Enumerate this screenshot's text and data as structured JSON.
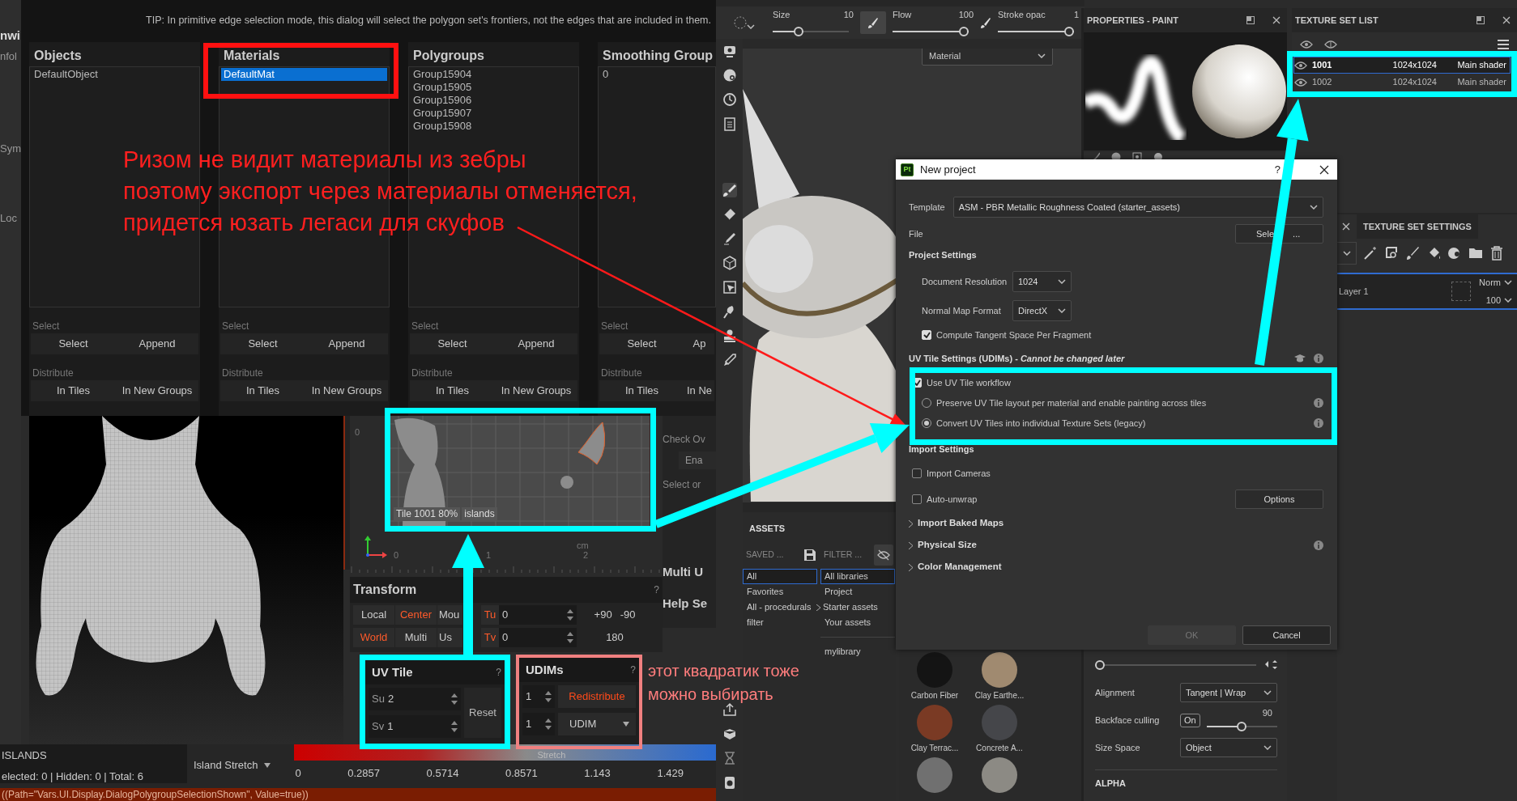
{
  "rizom": {
    "edge_labels": [
      "nwi",
      "nfol",
      "Sym",
      "Loc"
    ],
    "selection_dialog": {
      "tip": "TIP: In primitive edge selection mode, this dialog will select the polygon set's frontiers, not the edges that are included in them.",
      "columns": [
        {
          "title": "Objects",
          "items": [
            {
              "label": "DefaultObject",
              "selected": false
            }
          ],
          "select_label": "Select",
          "select_buttons": [
            "Select",
            "Append"
          ],
          "distribute_label": "Distribute",
          "distribute_buttons": [
            "In Tiles",
            "In New Groups"
          ]
        },
        {
          "title": "Materials",
          "items": [
            {
              "label": "DefaultMat",
              "selected": true
            }
          ],
          "select_label": "Select",
          "select_buttons": [
            "Select",
            "Append"
          ],
          "distribute_label": "Distribute",
          "distribute_buttons": [
            "In Tiles",
            "In New Groups"
          ]
        },
        {
          "title": "Polygroups",
          "items": [
            {
              "label": "Group15904",
              "selected": false
            },
            {
              "label": "Group15905",
              "selected": false
            },
            {
              "label": "Group15906",
              "selected": false
            },
            {
              "label": "Group15907",
              "selected": false
            },
            {
              "label": "Group15908",
              "selected": false
            }
          ],
          "select_label": "Select",
          "select_buttons": [
            "Select",
            "Append"
          ],
          "distribute_label": "Distribute",
          "distribute_buttons": [
            "In Tiles",
            "In New Groups"
          ]
        },
        {
          "title": "Smoothing Group",
          "items": [
            {
              "label": "0",
              "selected": false
            }
          ],
          "select_label": "Select",
          "select_buttons": [
            "Select",
            "Ap"
          ],
          "distribute_label": "Distribute",
          "distribute_buttons": [
            "In Tiles",
            "In Ne"
          ]
        }
      ]
    },
    "uv_view": {
      "tile_label": "Tile 1001 80%",
      "mode_label": "islands",
      "v_tick": "0",
      "u_ticks": [
        "0",
        "1",
        "2"
      ],
      "unit": "cm"
    },
    "side_labels": [
      {
        "text": "Check Ov",
        "kind": "label"
      },
      {
        "text": "Ena",
        "kind": "button"
      },
      {
        "text": "Select or",
        "kind": "label"
      },
      {
        "text": "Multi U",
        "kind": "heading"
      },
      {
        "text": "Help Se",
        "kind": "heading"
      }
    ],
    "transform": {
      "title": "Transform",
      "help": "?",
      "rows": [
        {
          "modes": [
            {
              "label": "Local",
              "selected": false
            },
            {
              "label": "Center",
              "selected": true
            },
            {
              "label": "Mou",
              "selected": false
            }
          ],
          "axis": "Tu",
          "value": "0",
          "presets": [
            "+90",
            "-90"
          ]
        },
        {
          "modes": [
            {
              "label": "World",
              "selected": true
            },
            {
              "label": "Multi",
              "selected": false
            },
            {
              "label": "Us",
              "selected": false
            }
          ],
          "axis": "Tv",
          "value": "0",
          "presets": [
            "180"
          ]
        }
      ]
    },
    "uv_tile": {
      "title": "UV Tile",
      "help": "?",
      "fields": [
        {
          "label": "Su",
          "value": "2"
        },
        {
          "label": "Sv",
          "value": "1"
        }
      ],
      "reset": "Reset"
    },
    "udims": {
      "title": "UDIMs",
      "help": "?",
      "fields": [
        "1",
        "1"
      ],
      "redistribute": "Redistribute",
      "mode": "UDIM"
    },
    "islands": {
      "title": "ISLANDS",
      "summary": "elected: 0 | Hidden: 0 | Total: 6",
      "display": "Island Stretch",
      "legend_label": "Stretch",
      "legend_ticks": [
        "0",
        "0.2857",
        "0.5714",
        "0.8571",
        "1.143",
        "1.429"
      ]
    },
    "status_line": "((Path=\"Vars.UI.Display.DialogPolygroupSelectionShown\", Value=true))"
  },
  "painter": {
    "toolbar": {
      "sliders": [
        {
          "label": "Size",
          "reading": "10",
          "level": 0.32
        },
        {
          "label": "Flow",
          "reading": "100",
          "level": 1
        },
        {
          "label": "Stroke opac",
          "reading": "1",
          "level": 1
        }
      ]
    },
    "viewport": {
      "channel": "Material"
    },
    "properties": {
      "title": "PROPERTIES - PAINT",
      "spacing_slider": {
        "level": 0
      },
      "alignment_label": "Alignment",
      "alignment": "Tangent | Wrap",
      "backface_label": "Backface culling",
      "backface": "On",
      "angle": "90",
      "angle_slider": {
        "level": 0.5
      },
      "size_space_label": "Size Space",
      "size_space": "Object",
      "section": "ALPHA"
    },
    "texture_sets": {
      "title": "TEXTURE SET LIST",
      "rows": [
        {
          "name": "1001",
          "size": "1024x1024",
          "shader": "Main shader",
          "selected": true
        },
        {
          "name": "1002",
          "size": "1024x1024",
          "shader": "Main shader",
          "selected": false
        }
      ]
    },
    "texture_set_settings": {
      "title": "TEXTURE SET SETTINGS",
      "layers": [
        {
          "name": "Layer 1",
          "blend": "Norm",
          "opacity": "100"
        }
      ]
    },
    "assets": {
      "title": "ASSETS",
      "saved_label": "SAVED ...",
      "filter_label": "FILTER ...",
      "saved": [
        {
          "label": "All",
          "selected": true
        },
        {
          "label": "Favorites",
          "selected": false
        },
        {
          "label": "All - procedurals",
          "selected": false
        },
        {
          "label": "filter",
          "selected": false
        }
      ],
      "libraries": [
        {
          "label": "All libraries",
          "selected": true,
          "expandable": false
        },
        {
          "label": "Project",
          "selected": false,
          "expandable": false
        },
        {
          "label": "Starter assets",
          "selected": false,
          "expandable": true
        },
        {
          "label": "Your assets",
          "selected": false,
          "expandable": false
        }
      ],
      "extra_library": "mylibrary",
      "materials": [
        {
          "name": "Carbon Fiber",
          "color": "#141414"
        },
        {
          "name": "Clay Earthe...",
          "color": "#a08a70"
        },
        {
          "name": "Clay Terrac...",
          "color": "#7a3a24"
        },
        {
          "name": "Concrete A...",
          "color": "#45464a"
        },
        {
          "color": "#707070"
        },
        {
          "color": "#8c8a84"
        }
      ]
    },
    "new_project": {
      "logo": "Pt",
      "title": "New project",
      "help": "?",
      "template_label": "Template",
      "template": "ASM - PBR Metallic Roughness Coated (starter_assets)",
      "file_label": "File",
      "file_button": "Sele ...",
      "project_heading": "Project Settings",
      "settings": [
        {
          "label": "Document Resolution",
          "value": "1024"
        },
        {
          "label": "Normal Map Format",
          "value": "DirectX"
        }
      ],
      "tangent": {
        "label": "Compute Tangent Space Per Fragment",
        "checked": true
      },
      "uv_heading": "UV Tile Settings (UDIMs) - *Cannot be changed later*",
      "uv_workflow": {
        "label": "Use UV Tile workflow",
        "checked": true
      },
      "uv_modes": [
        {
          "label": "Preserve UV Tile layout per material and enable painting across tiles",
          "selected": false
        },
        {
          "label": "Convert UV Tiles into individual Texture Sets (legacy)",
          "selected": true
        }
      ],
      "import_heading": "Import Settings",
      "import_options": [
        {
          "label": "Import Cameras",
          "checked": false
        },
        {
          "label": "Auto-unwrap",
          "checked": false,
          "button": "Options"
        }
      ],
      "sections": [
        {
          "label": "Import Baked Maps",
          "info": false
        },
        {
          "label": "Physical Size",
          "info": true
        },
        {
          "label": "Color Management",
          "info": false
        }
      ],
      "ok": {
        "label": "OK",
        "disabled": true
      },
      "cancel": "Cancel"
    }
  },
  "notes": [
    {
      "text": "Ризом не видит материалы из зебры\nпоэтому экспорт через материалы отменяется,\nпридется юзать легаси для скуфов",
      "color": "#ff1f1f",
      "kind": "main"
    },
    {
      "text": "этот квадратик тоже\nможно выбирать",
      "color": "#ff7d7d",
      "kind": "side"
    }
  ]
}
